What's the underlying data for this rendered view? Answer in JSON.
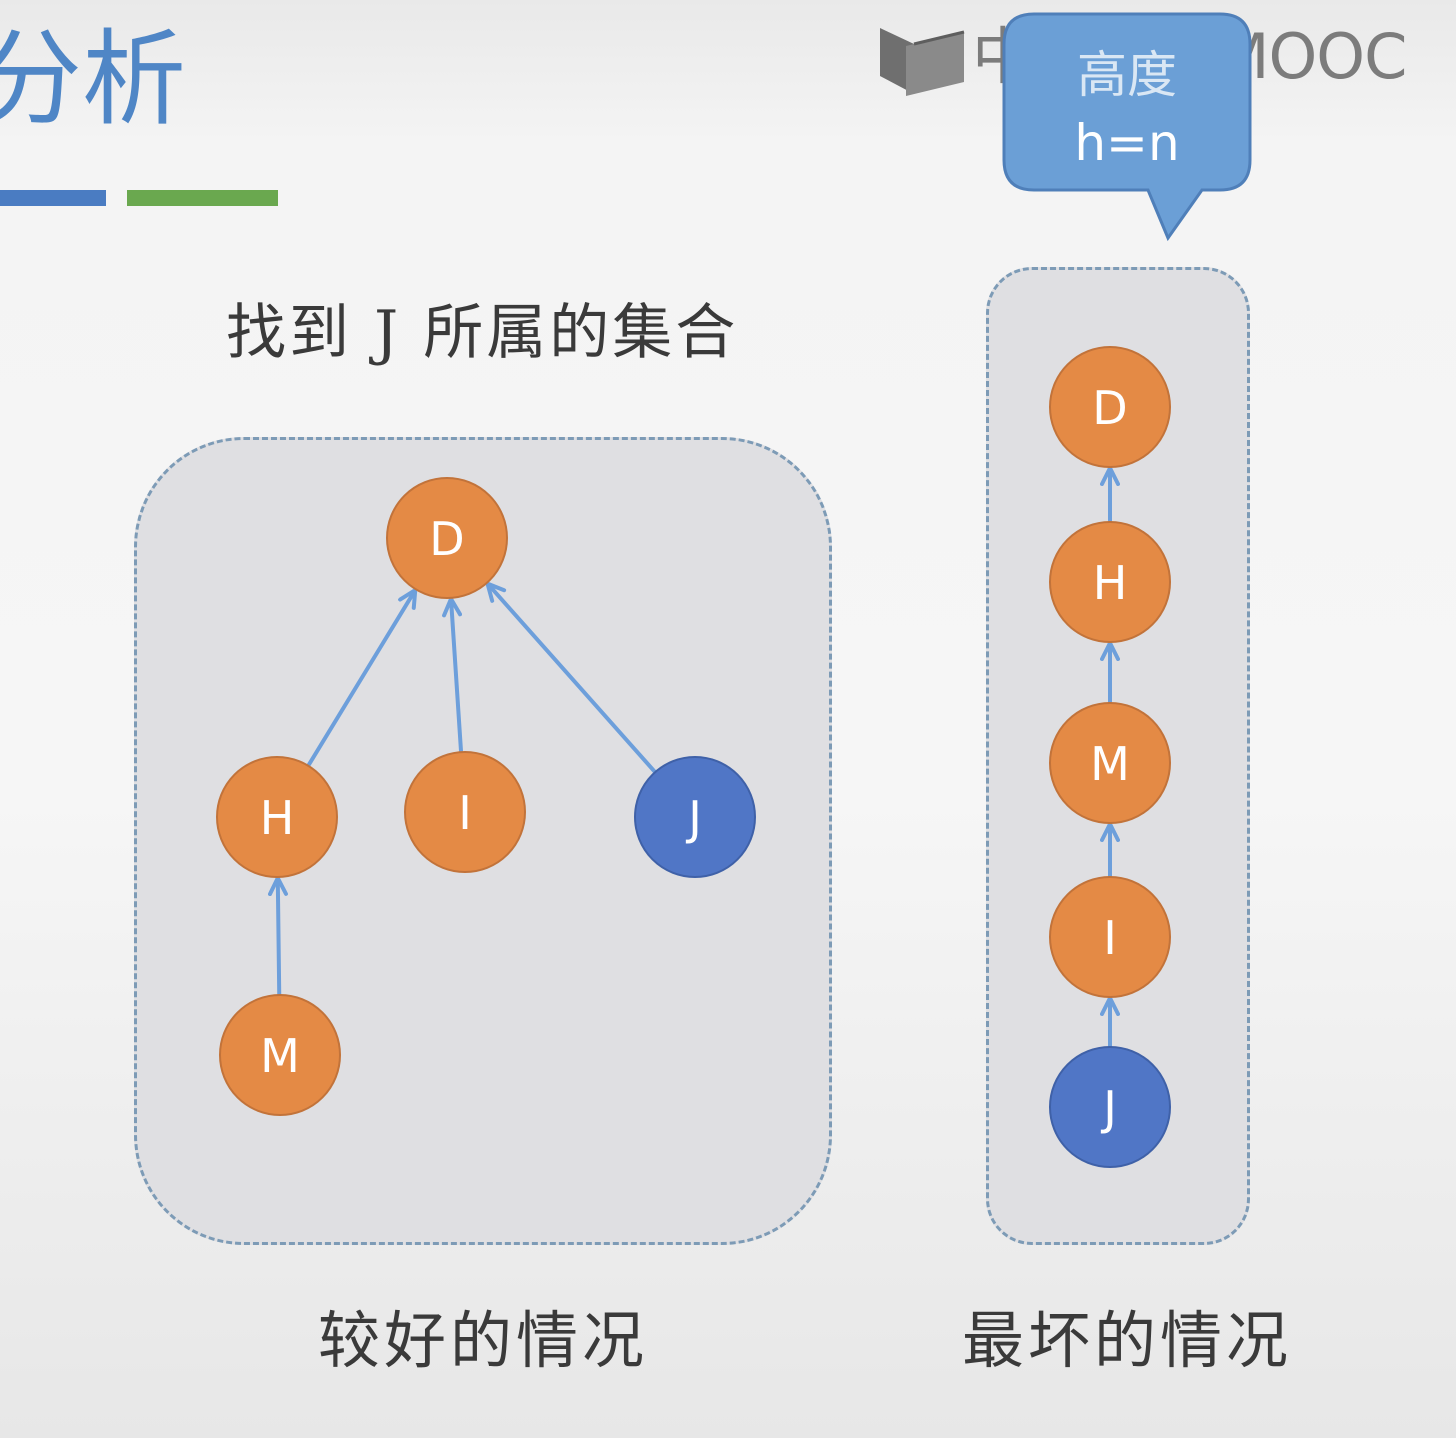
{
  "slide": {
    "title_partial": "分析",
    "accent_colors": {
      "blue": "#4a7cc2",
      "green": "#6aa84f"
    }
  },
  "watermark": {
    "text": "中国大学MOOC",
    "icon": "book-icon"
  },
  "callout": {
    "label": "高度",
    "formula": "h=n",
    "color": "#6b9fd6"
  },
  "captions": {
    "find": "找到 J 所属的集合",
    "better": "较好的情况",
    "worst": "最坏的情况"
  },
  "colors": {
    "node_default": "#e48a45",
    "node_highlight": "#5076c6",
    "edge": "#6d9fdb"
  },
  "better_tree": {
    "nodes": [
      {
        "id": "D",
        "label": "D"
      },
      {
        "id": "H",
        "label": "H"
      },
      {
        "id": "I",
        "label": "I"
      },
      {
        "id": "J",
        "label": "J",
        "highlight": true
      },
      {
        "id": "M",
        "label": "M"
      }
    ],
    "edges": [
      {
        "from": "H",
        "to": "D"
      },
      {
        "from": "I",
        "to": "D"
      },
      {
        "from": "J",
        "to": "D"
      },
      {
        "from": "M",
        "to": "H"
      }
    ]
  },
  "worst_chain": {
    "nodes": [
      {
        "id": "D",
        "label": "D"
      },
      {
        "id": "H",
        "label": "H"
      },
      {
        "id": "M",
        "label": "M"
      },
      {
        "id": "I",
        "label": "I"
      },
      {
        "id": "J",
        "label": "J",
        "highlight": true
      }
    ],
    "edges": [
      {
        "from": "H",
        "to": "D"
      },
      {
        "from": "M",
        "to": "H"
      },
      {
        "from": "I",
        "to": "M"
      },
      {
        "from": "J",
        "to": "I"
      }
    ]
  }
}
